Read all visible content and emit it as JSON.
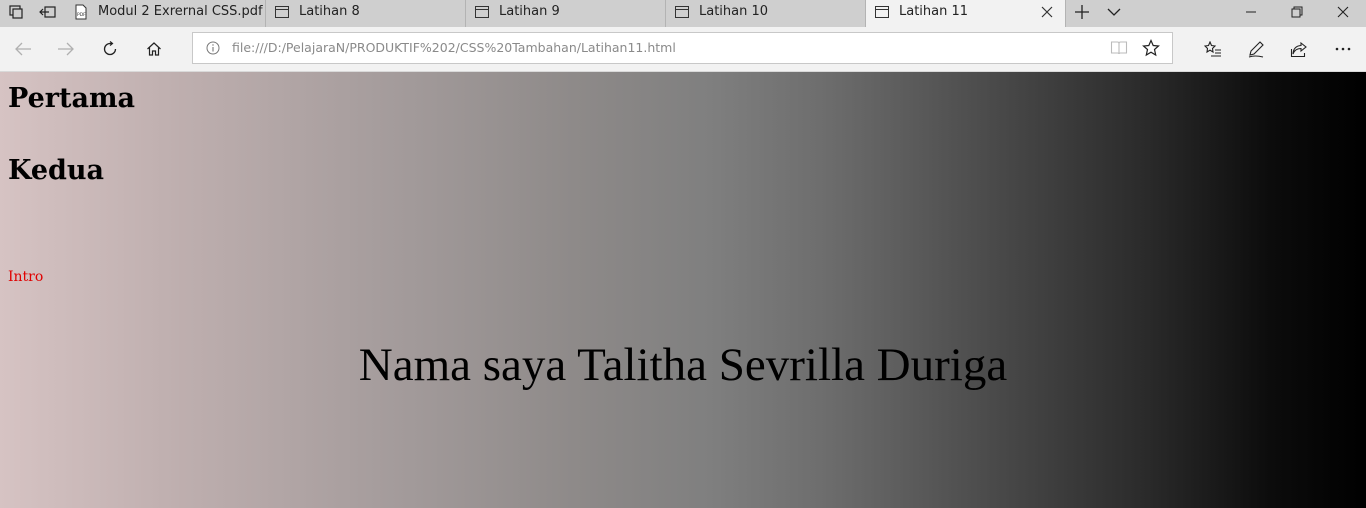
{
  "browser": {
    "tabs": [
      {
        "label": "Modul 2 Exrernal CSS.pdf",
        "icon": "pdf-icon",
        "active": false
      },
      {
        "label": "Latihan 8",
        "icon": "page-icon",
        "active": false
      },
      {
        "label": "Latihan 9",
        "icon": "page-icon",
        "active": false
      },
      {
        "label": "Latihan 10",
        "icon": "page-icon",
        "active": false
      },
      {
        "label": "Latihan 11",
        "icon": "page-icon",
        "active": true
      }
    ],
    "address": {
      "url": "file:///D:/PelajaraN/PRODUKTIF%202/CSS%20Tambahan/Latihan11.html"
    }
  },
  "page": {
    "heading1": "Pertama",
    "heading2": "Kedua",
    "intro": "Intro",
    "name_line": "Nama saya Talitha Sevrilla Duriga"
  },
  "colors": {
    "intro_text": "#e00000",
    "gradient_start": "#d6c3c3",
    "gradient_end": "#000000"
  }
}
